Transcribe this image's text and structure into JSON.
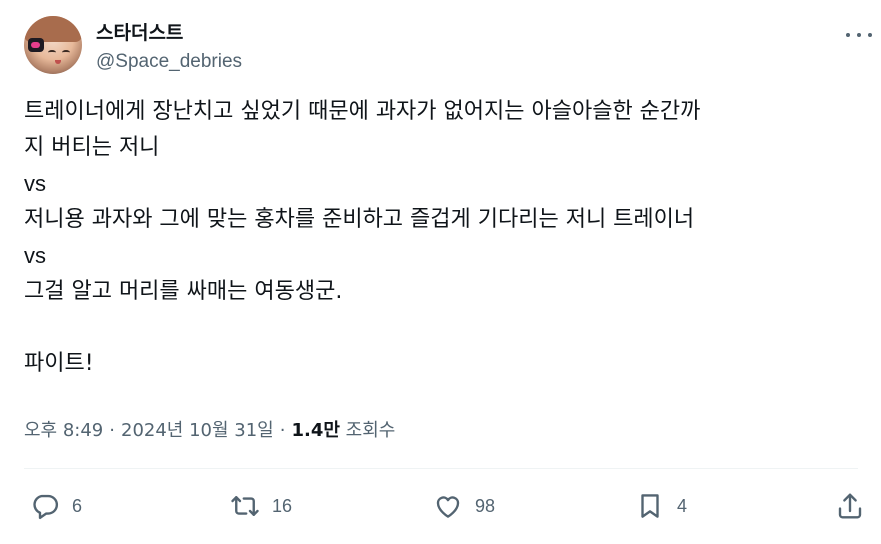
{
  "author": {
    "display_name": "스타더스트",
    "handle": "@Space_debries"
  },
  "tweet": {
    "lines": [
      "트레이너에게 장난치고 싶었기 때문에 과자가 없어지는 아슬아슬한 순간까",
      "지 버티는 저니",
      "vs",
      "저니용 과자와 그에 맞는 홍차를 준비하고 즐겁게 기다리는 저니 트레이너",
      "vs",
      "그걸 알고 머리를 싸매는 여동생군.",
      "",
      "파이트!"
    ]
  },
  "meta": {
    "time": "오후 8:49",
    "date": "2024년 10월 31일",
    "separator": "·",
    "views_count": "1.4만",
    "views_label": "조회수"
  },
  "actions": {
    "reply_count": "6",
    "retweet_count": "16",
    "like_count": "98",
    "bookmark_count": "4"
  },
  "icons": {
    "reply": "speech-bubble-icon",
    "retweet": "retweet-arrows-icon",
    "like": "heart-icon",
    "bookmark": "bookmark-icon",
    "share": "share-upload-icon",
    "more": "more-dots-icon"
  },
  "colors": {
    "text": "#0f1419",
    "secondary": "#536471",
    "divider": "#eff3f4"
  }
}
